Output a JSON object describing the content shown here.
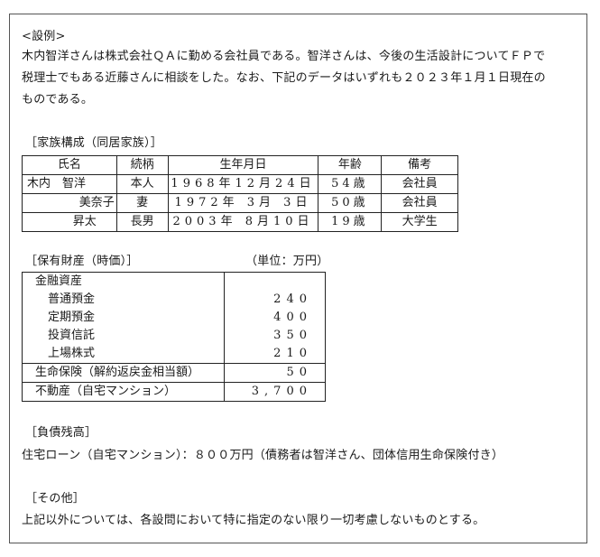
{
  "intro": {
    "heading": "<設例>",
    "lines": [
      "木内智洋さんは株式会社ＱＡに勤める会社員である。智洋さんは、今後の生活設計についてＦＰで",
      "税理士でもある近藤さんに相談をした。なお、下記のデータはいずれも２０２３年１月１日現在の",
      "ものである。"
    ]
  },
  "family": {
    "title": "［家族構成（同居家族）］",
    "headers": [
      "氏名",
      "続柄",
      "生年月日",
      "年齢",
      "備考"
    ],
    "rows": [
      {
        "name": "木内　智洋",
        "relation": "本人",
        "birth": "1968年12月24日",
        "age": "54歳",
        "note": "会社員"
      },
      {
        "name": "美奈子",
        "relation": "妻",
        "birth": "1972年 3月 3日",
        "age": "50歳",
        "note": "会社員"
      },
      {
        "name": "昇太",
        "relation": "長男",
        "birth": "2003年 8月10日",
        "age": "19歳",
        "note": "大学生"
      }
    ]
  },
  "assets": {
    "title": "［保有財産（時価）］",
    "unit": "（単位：万円）",
    "financial_label": "金融資産",
    "financial_items": [
      {
        "label": "普通預金",
        "value": "240"
      },
      {
        "label": "定期預金",
        "value": "400"
      },
      {
        "label": "投資信託",
        "value": "350"
      },
      {
        "label": "上場株式",
        "value": "210"
      }
    ],
    "insurance": {
      "label": "生命保険（解約返戻金相当額）",
      "value": "50"
    },
    "real_estate": {
      "label": "不動産（自宅マンション）",
      "value": "3,700"
    }
  },
  "liabilities": {
    "title": "［負債残高］",
    "text": "住宅ローン（自宅マンション）：８００万円（債務者は智洋さん、団体信用生命保険付き）"
  },
  "other": {
    "title": "［その他］",
    "text": "上記以外については、各設問において特に指定のない限り一切考慮しないものとする。"
  }
}
